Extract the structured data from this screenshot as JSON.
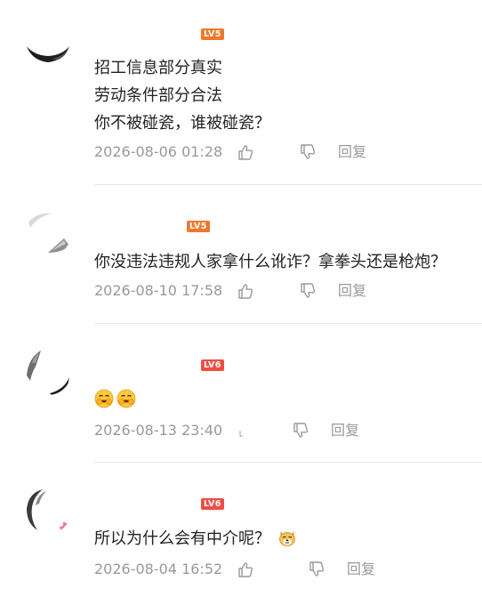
{
  "comments": [
    {
      "level": "LV5",
      "lines": [
        "招工信息部分真实",
        "劳动条件部分合法",
        "你不被碰瓷，谁被碰瓷？"
      ],
      "time": "2026-08-06 01:28",
      "reply_label": "回复"
    },
    {
      "level": "LV5",
      "lines": [
        "你没违法违规人家拿什么讹诈？拿拳头还是枪炮？"
      ],
      "time": "2026-08-10 17:58",
      "reply_label": "回复"
    },
    {
      "level": "LV6",
      "lines": [
        ""
      ],
      "emojis": [
        "grin-emoji",
        "grin-emoji"
      ],
      "time": "2026-08-13 23:40",
      "reply_label": "回复"
    },
    {
      "level": "LV6",
      "lines": [
        "所以为什么会有中介呢？"
      ],
      "emojis": [
        "doge-emoji"
      ],
      "time": "2026-08-04 16:52",
      "reply_label": "回复"
    }
  ],
  "colors": {
    "lv5": "#f0772c",
    "lv6": "#ee4d44",
    "text": "#222222",
    "meta": "#999999",
    "divider": "#e8e8e8"
  },
  "icons": [
    "thumb-up-icon",
    "thumb-down-icon",
    "grin-emoji",
    "doge-emoji"
  ]
}
